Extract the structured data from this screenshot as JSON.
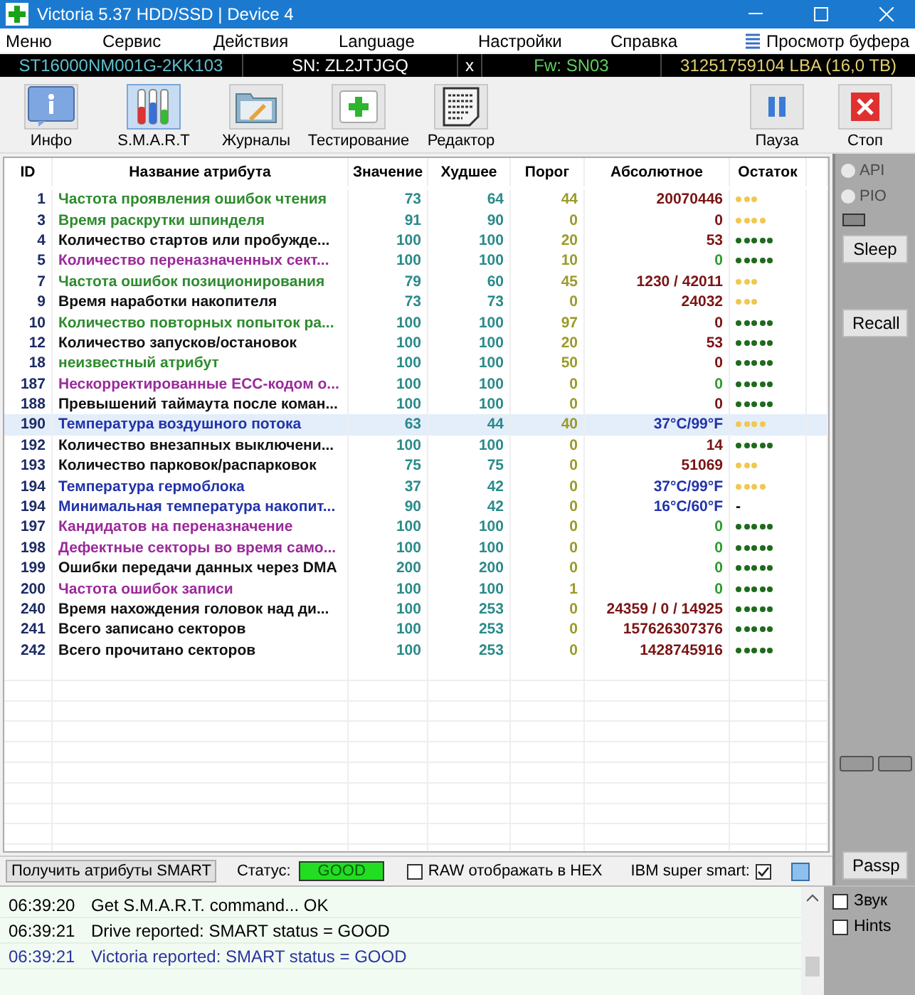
{
  "window": {
    "title": "Victoria 5.37 HDD/SSD | Device 4"
  },
  "menu": [
    "Меню",
    "Сервис",
    "Действия",
    "Language",
    "Настройки",
    "Справка"
  ],
  "buffer_view": "Просмотр буфера",
  "device": {
    "model": "ST16000NM001G-2KK103",
    "serial": "SN: ZL2JTJGQ",
    "close": "x",
    "firmware": "Fw: SN03",
    "capacity": "31251759104 LBA (16,0 TB)"
  },
  "toolbar": [
    {
      "label": "Инфо",
      "kind": "info",
      "selected": false
    },
    {
      "label": "S.M.A.R.T",
      "kind": "smart",
      "selected": true
    },
    {
      "label": "Журналы",
      "kind": "logs",
      "selected": false
    },
    {
      "label": "Тестирование",
      "kind": "test",
      "selected": false
    },
    {
      "label": "Редактор",
      "kind": "editor",
      "selected": false
    }
  ],
  "toolbar_right": [
    {
      "label": "Пауза",
      "kind": "pause"
    },
    {
      "label": "Стоп",
      "kind": "stop"
    }
  ],
  "table": {
    "columns": [
      "ID",
      "Название атрибута",
      "Значение",
      "Худшее",
      "Порог",
      "Абсолютное",
      "Остаток"
    ],
    "rows": [
      {
        "id": "1",
        "name": "Частота проявления ошибок чтения",
        "color": "#2e8b2e",
        "value": "73",
        "worst": "64",
        "threshold": "44",
        "raw": "20070446",
        "kind": "normal",
        "stars": 3,
        "selected": false
      },
      {
        "id": "3",
        "name": "Время раскрутки шпинделя",
        "color": "#2e8b2e",
        "value": "91",
        "worst": "90",
        "threshold": "0",
        "raw": "0",
        "kind": "normal",
        "stars": 4,
        "selected": false
      },
      {
        "id": "4",
        "name": "Количество стартов или пробужде...",
        "color": "#111111",
        "value": "100",
        "worst": "100",
        "threshold": "20",
        "raw": "53",
        "kind": "normal",
        "stars": 5,
        "selected": false
      },
      {
        "id": "5",
        "name": "Количество переназначенных сект...",
        "color": "#9b2a9b",
        "value": "100",
        "worst": "100",
        "threshold": "10",
        "raw": "0",
        "kind": "ok",
        "stars": 5,
        "selected": false
      },
      {
        "id": "7",
        "name": "Частота ошибок позиционирования",
        "color": "#2e8b2e",
        "value": "79",
        "worst": "60",
        "threshold": "45",
        "raw": "1230 / 42011",
        "kind": "normal",
        "stars": 3,
        "selected": false
      },
      {
        "id": "9",
        "name": "Время наработки накопителя",
        "color": "#111111",
        "value": "73",
        "worst": "73",
        "threshold": "0",
        "raw": "24032",
        "kind": "normal",
        "stars": 3,
        "selected": false
      },
      {
        "id": "10",
        "name": "Количество повторных попыток ра...",
        "color": "#2e8b2e",
        "value": "100",
        "worst": "100",
        "threshold": "97",
        "raw": "0",
        "kind": "normal",
        "stars": 5,
        "selected": false
      },
      {
        "id": "12",
        "name": "Количество запусков/остановок",
        "color": "#111111",
        "value": "100",
        "worst": "100",
        "threshold": "20",
        "raw": "53",
        "kind": "normal",
        "stars": 5,
        "selected": false
      },
      {
        "id": "18",
        "name": "неизвестный атрибут",
        "color": "#2e8b2e",
        "value": "100",
        "worst": "100",
        "threshold": "50",
        "raw": "0",
        "kind": "normal",
        "stars": 5,
        "selected": false
      },
      {
        "id": "187",
        "name": "Нескорректированные ECC-кодом о...",
        "color": "#9b2a9b",
        "value": "100",
        "worst": "100",
        "threshold": "0",
        "raw": "0",
        "kind": "ok",
        "stars": 5,
        "selected": false
      },
      {
        "id": "188",
        "name": "Превышений таймаута после коман...",
        "color": "#111111",
        "value": "100",
        "worst": "100",
        "threshold": "0",
        "raw": "0",
        "kind": "normal",
        "stars": 5,
        "selected": false
      },
      {
        "id": "190",
        "name": "Температура воздушного потока",
        "color": "#2233aa",
        "value": "63",
        "worst": "44",
        "threshold": "40",
        "raw": "37°C/99°F",
        "kind": "temperature",
        "stars": 4,
        "selected": true
      },
      {
        "id": "192",
        "name": "Количество внезапных выключени...",
        "color": "#111111",
        "value": "100",
        "worst": "100",
        "threshold": "0",
        "raw": "14",
        "kind": "normal",
        "stars": 5,
        "selected": false
      },
      {
        "id": "193",
        "name": "Количество парковок/распарковок",
        "color": "#111111",
        "value": "75",
        "worst": "75",
        "threshold": "0",
        "raw": "51069",
        "kind": "normal",
        "stars": 3,
        "selected": false
      },
      {
        "id": "194",
        "name": "Температура гермоблока",
        "color": "#2233aa",
        "value": "37",
        "worst": "42",
        "threshold": "0",
        "raw": "37°C/99°F",
        "kind": "temperature",
        "stars": 4,
        "selected": false
      },
      {
        "id": "194",
        "name": "Минимальная температура накопит...",
        "color": "#2233aa",
        "value": "90",
        "worst": "42",
        "threshold": "0",
        "raw": "16°C/60°F",
        "kind": "temperature",
        "remaining": "-",
        "selected": false
      },
      {
        "id": "197",
        "name": "Кандидатов на переназначение",
        "color": "#9b2a9b",
        "value": "100",
        "worst": "100",
        "threshold": "0",
        "raw": "0",
        "kind": "ok",
        "stars": 5,
        "selected": false
      },
      {
        "id": "198",
        "name": "Дефектные секторы во время само...",
        "color": "#9b2a9b",
        "value": "100",
        "worst": "100",
        "threshold": "0",
        "raw": "0",
        "kind": "ok",
        "stars": 5,
        "selected": false
      },
      {
        "id": "199",
        "name": "Ошибки передачи данных через DMA",
        "color": "#111111",
        "value": "200",
        "worst": "200",
        "threshold": "0",
        "raw": "0",
        "kind": "ok",
        "stars": 5,
        "selected": false
      },
      {
        "id": "200",
        "name": "Частота ошибок записи",
        "color": "#9b2a9b",
        "value": "100",
        "worst": "100",
        "threshold": "1",
        "raw": "0",
        "kind": "ok",
        "stars": 5,
        "selected": false
      },
      {
        "id": "240",
        "name": "Время нахождения головок над ди...",
        "color": "#111111",
        "value": "100",
        "worst": "253",
        "threshold": "0",
        "raw": "24359 / 0 / 14925",
        "kind": "normal",
        "stars": 5,
        "selected": false
      },
      {
        "id": "241",
        "name": "Всего записано секторов",
        "color": "#111111",
        "value": "100",
        "worst": "253",
        "threshold": "0",
        "raw": "157626307376",
        "kind": "normal",
        "stars": 5,
        "selected": false
      },
      {
        "id": "242",
        "name": "Всего прочитано секторов",
        "color": "#111111",
        "value": "100",
        "worst": "253",
        "threshold": "0",
        "raw": "1428745916",
        "kind": "normal",
        "stars": 5,
        "selected": false
      }
    ]
  },
  "side": {
    "radios": [
      {
        "label": "API",
        "selected": false,
        "disabled": true
      },
      {
        "label": "PIO",
        "selected": false,
        "disabled": true
      }
    ],
    "buttons": [
      "Sleep",
      "Recall"
    ],
    "bottom_button": "Passp"
  },
  "bottom": {
    "get_button": "Получить атрибуты SMART",
    "status_label": "Статус:",
    "status": "GOOD",
    "raw_hex": {
      "label": "RAW отображать в HEX",
      "checked": false
    },
    "ibm": {
      "label": "IBM super smart:",
      "checked": true
    }
  },
  "log": [
    {
      "time": "06:39:20",
      "text": "Get S.M.A.R.T. command... OK",
      "kind": "normal"
    },
    {
      "time": "06:39:21",
      "text": "Drive reported: SMART status = GOOD",
      "kind": "normal"
    },
    {
      "time": "06:39:21",
      "text": "Victoria reported: SMART status = GOOD",
      "kind": "highlight"
    }
  ],
  "options": [
    {
      "label": "Звук",
      "checked": false
    },
    {
      "label": "Hints",
      "checked": false
    }
  ]
}
